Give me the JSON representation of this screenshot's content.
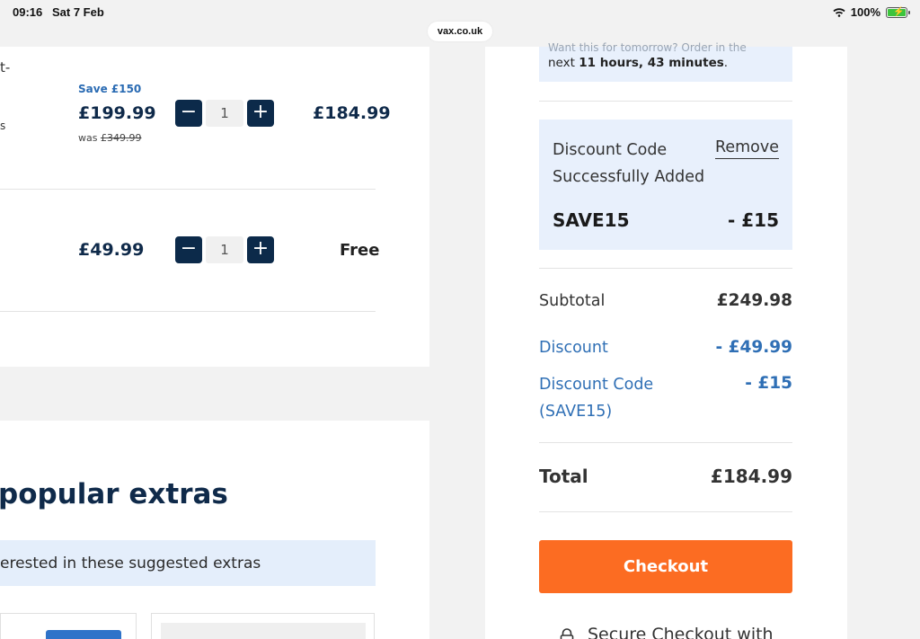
{
  "status_bar": {
    "time": "09:16",
    "date": "Sat 7 Feb",
    "battery": "100%"
  },
  "browser": {
    "url": "vax.co.uk"
  },
  "cart": {
    "partial_texts": [
      "t-",
      "s"
    ],
    "items": [
      {
        "save_label": "Save £150",
        "price": "£199.99",
        "was_prefix": "was",
        "was_price": "£349.99",
        "quantity": "1",
        "total": "£184.99"
      },
      {
        "price": "£49.99",
        "quantity": "1",
        "total": "Free"
      }
    ]
  },
  "extras": {
    "title": "popular extras",
    "banner": "erested in these suggested extras"
  },
  "summary": {
    "delivery_cut": "Want this for tomorrow? Order in the",
    "delivery_prefix": "next",
    "delivery_time": "11 hours, 43 minutes",
    "delivery_suffix": ".",
    "discount_message": "Discount Code Successfully Added",
    "remove_label": "Remove",
    "discount_code": "SAVE15",
    "discount_code_amount": "- £15",
    "subtotal_label": "Subtotal",
    "subtotal_value": "£249.98",
    "discount_label": "Discount",
    "discount_value": "- £49.99",
    "discount_code_label": "Discount Code (SAVE15)",
    "discount_code_value": "- £15",
    "total_label": "Total",
    "total_value": "£184.99",
    "checkout_label": "Checkout",
    "secure_text": "Secure Checkout with"
  },
  "colors": {
    "accent": "#fc6c22",
    "navy": "#0c2a4a",
    "link_blue": "#2f6fb5",
    "panel_blue": "#e8f0fc"
  }
}
